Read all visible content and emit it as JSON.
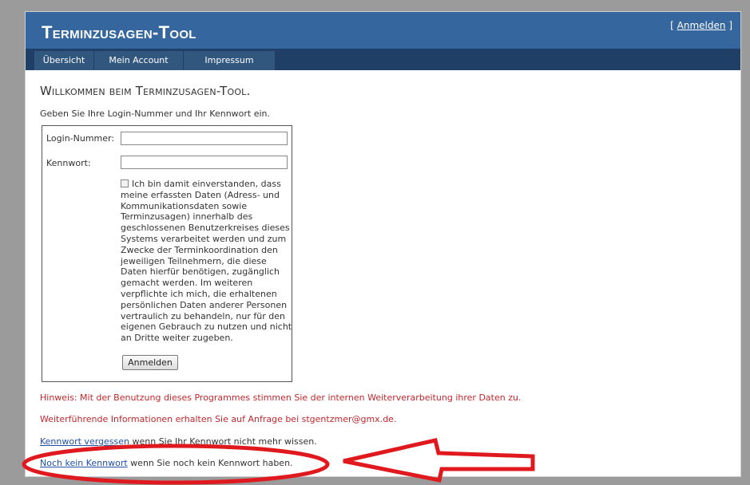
{
  "header": {
    "title": "Terminzusagen-Tool",
    "login_bracket_open": "[ ",
    "login_link": "Anmelden",
    "login_bracket_close": " ]"
  },
  "nav": {
    "tabs": [
      "Übersicht",
      "Mein Account",
      "Impressum"
    ]
  },
  "main": {
    "welcome": "Willkommen beim Terminzusagen-Tool.",
    "intro": "Geben Sie Ihre Login-Nummer und Ihr Kennwort ein.",
    "form": {
      "login_label": "Login-Nummer:",
      "login_value": "",
      "password_label": "Kennwort:",
      "password_value": "",
      "consent_text": "Ich bin damit einverstanden, dass meine erfassten Daten (Adress- und Kommunikationsdaten sowie Terminzusagen) innerhalb des geschlossenen Benutzerkreises dieses Systems verarbeitet werden und zum Zwecke der Terminkoordination den jeweiligen Teilnehmern, die diese Daten hierfür benötigen, zugänglich gemacht werden. Im weiteren verpflichte ich mich, die erhaltenen persönlichen Daten anderer Personen vertraulich zu behandeln, nur für den eigenen Gebrauch zu nutzen und nicht an Dritte weiter zugeben.",
      "submit_label": "Anmelden"
    },
    "notice_1": "Hinweis: Mit der Benutzung dieses Programmes stimmen Sie der internen Weiterverarbeitung ihrer Daten zu.",
    "notice_2": "Weiterführende Informationen erhalten Sie auf Anfrage bei stgentzmer@gmx.de.",
    "forgot_link": "Kennwort vergessen",
    "forgot_text": " wenn Sie Ihr Kennwort nicht mehr wissen.",
    "nopw_link": "Noch kein Kennwort",
    "nopw_text": " wenn Sie noch kein Kennwort haben."
  },
  "colors": {
    "header_bg": "#35669d",
    "nav_bg": "#1f3f66",
    "tab_bg": "#32577f",
    "notice_red": "#c0272d",
    "link_blue": "#1f4fa8",
    "annotation_red": "#e0191f"
  }
}
